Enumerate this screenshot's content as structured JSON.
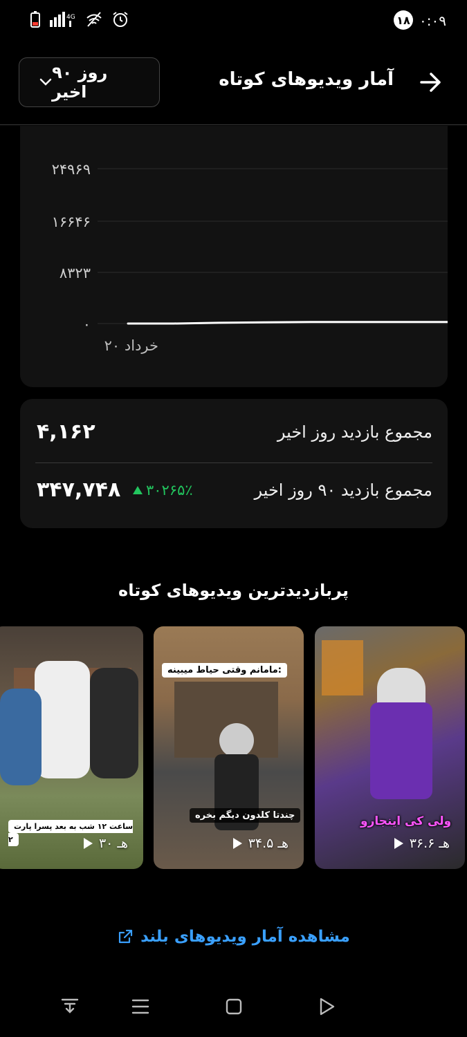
{
  "status": {
    "time": "۰:۰۹",
    "notifications": "۱۸",
    "network": "4G"
  },
  "header": {
    "title": "آمار ویدیوهای کوتاه",
    "range_label": "۹۰ روز اخیر"
  },
  "chart_data": {
    "type": "line",
    "y_ticks": [
      "۲۴۹۶۹",
      "۱۶۶۴۶",
      "۸۳۲۳",
      "۰"
    ],
    "x_label": "۲۰ خرداد",
    "ylim": [
      0,
      24969
    ],
    "series": [
      {
        "values": [
          0,
          0,
          120,
          200,
          260,
          240,
          260,
          240
        ]
      }
    ]
  },
  "stats": {
    "day_label": "مجموع بازدید روز اخیر",
    "day_value": "۴,۱۶۲",
    "ninety_label": "مجموع بازدید ۹۰ روز اخیر",
    "ninety_value": "۳۴۷,۷۴۸",
    "ninety_change": "۳۰۲۶۵٪",
    "positive_color": "#22c55e"
  },
  "section_title": "پربازدیدترین ویدیوهای کوتاه",
  "videos": [
    {
      "views": "۳۶.۶ هـ",
      "caption": "ولی کی اینجارو"
    },
    {
      "views": "۳۴.۵ هـ",
      "caption_top": "مامانم وقتی حیاط میبینه:",
      "caption": "چندتا کلدون دیگم بخره"
    },
    {
      "views": "۳۰ هـ",
      "caption": "ساعت ۱۲ شب به بعد پسرا پارت ۲"
    }
  ],
  "footer_link": "مشاهده آمار ویدیوهای بلند",
  "nav": [
    "notifications-icon",
    "menu-icon",
    "home-icon",
    "back-icon"
  ]
}
